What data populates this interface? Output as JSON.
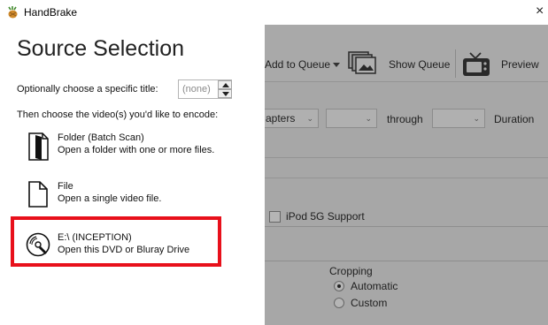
{
  "window": {
    "title": "HandBrake",
    "close_glyph": "×",
    "app_icon": "handbrake-pineapple-icon"
  },
  "source_selection": {
    "heading": "Source Selection",
    "title_prompt": "Optionally choose a specific title:",
    "title_spinner_value": "(none)",
    "video_prompt": "Then choose the video(s) you'd like to encode:",
    "options": [
      {
        "icon": "folder-icon",
        "title": "Folder (Batch Scan)",
        "description": "Open a folder with one or more files."
      },
      {
        "icon": "file-icon",
        "title": "File",
        "description": "Open a single video file."
      },
      {
        "icon": "dvd-disc-icon",
        "title": "E:\\ (INCEPTION)",
        "description": "Open this DVD or Bluray Drive"
      }
    ],
    "highlight_color": "#e8101b"
  },
  "background_window": {
    "toolbar": {
      "add_to_queue": "Add to Queue",
      "show_queue": "Show Queue",
      "preview": "Preview"
    },
    "range": {
      "type_value": "apters",
      "through": "through",
      "duration": "Duration"
    },
    "ipod_support": "iPod 5G Support",
    "cropping": {
      "label": "Cropping",
      "options": [
        "Automatic",
        "Custom"
      ],
      "selected": "Automatic"
    }
  }
}
